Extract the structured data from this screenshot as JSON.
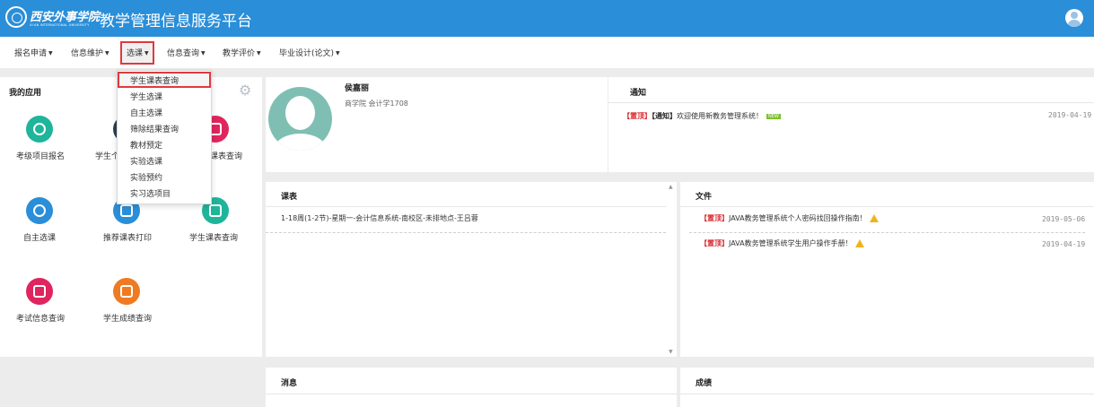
{
  "header": {
    "school_logo_text": "西安外事学院",
    "school_logo_subtext": "XI'AN INTERNATIONAL UNIVERSITY",
    "app_title": "教学管理信息服务平台"
  },
  "nav": {
    "items": [
      "报名申请",
      "信息维护",
      "选课",
      "信息查询",
      "教学评价",
      "毕业设计(论文)"
    ]
  },
  "dropdown": {
    "items": [
      "学生课表查询",
      "学生选课",
      "自主选课",
      "筛除结果查询",
      "教材预定",
      "实验选课",
      "实验预约",
      "实习选项目"
    ]
  },
  "my_apps": {
    "title": "我的应用",
    "items": [
      {
        "label": "考级项目报名",
        "color": "#1fb59a",
        "icon": "chat-icon"
      },
      {
        "label": "学生个",
        "color": "#2c3e50",
        "icon": "user-icon"
      },
      {
        "label": "课表查询",
        "color": "#e0245e",
        "icon": "book-icon"
      },
      {
        "label": "自主选课",
        "color": "#2a8ed8",
        "icon": "ball-icon"
      },
      {
        "label": "推荐课表打印",
        "color": "#2a8ed8",
        "icon": "print-icon"
      },
      {
        "label": "学生课表查询",
        "color": "#1fb59a",
        "icon": "book-icon"
      },
      {
        "label": "考试信息查询",
        "color": "#e0245e",
        "icon": "search-doc-icon"
      },
      {
        "label": "学生成绩查询",
        "color": "#f07a22",
        "icon": "grade-icon"
      }
    ]
  },
  "profile": {
    "name": "侯嘉丽",
    "info": "商学院 会计学1708"
  },
  "notice": {
    "title": "通知",
    "items": [
      {
        "tag1": "【置顶】",
        "tag2": "【通知】",
        "text": "欢迎使用新教务管理系统！",
        "badge": "NEW",
        "date": "2019-04-19"
      }
    ]
  },
  "schedule": {
    "title": "课表",
    "line": "1-18周(1-2节)-星期一-会计信息系统-南校区-未排地点-王吕蓉"
  },
  "files": {
    "title": "文件",
    "items": [
      {
        "tag": "【置顶】",
        "text": "JAVA教务管理系统个人密码找回操作指南！",
        "date": "2019-05-06"
      },
      {
        "tag": "【置顶】",
        "text": "JAVA教务管理系统学生用户操作手册！",
        "date": "2019-04-19"
      }
    ]
  },
  "messages": {
    "title": "消息"
  },
  "grades": {
    "title": "成绩"
  }
}
